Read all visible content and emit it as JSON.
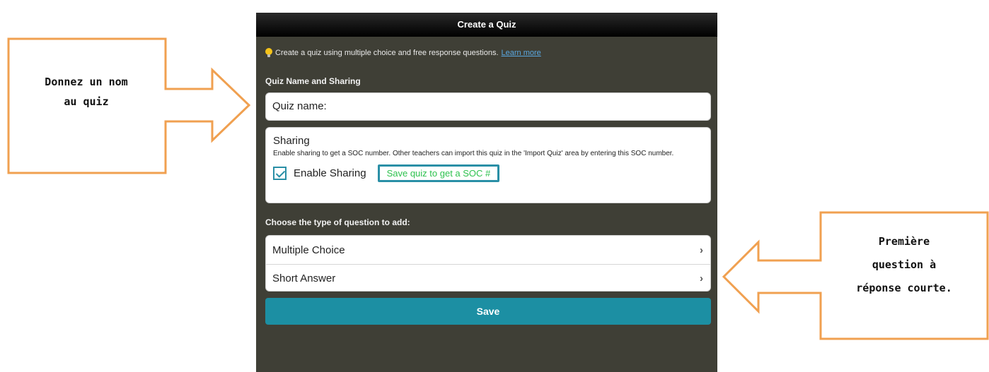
{
  "panel": {
    "title": "Create a Quiz",
    "info_text": "Create a quiz using multiple choice and free response questions.",
    "info_link": "Learn more",
    "section_quiz": "Quiz Name and Sharing",
    "quiz_name_placeholder": "Quiz name:",
    "sharing": {
      "title": "Sharing",
      "description": "Enable sharing to get a SOC number. Other teachers can import this quiz in the 'Import Quiz' area by entering this SOC number.",
      "checkbox_label": "Enable Sharing",
      "checked": true,
      "soc_button": "Save quiz to get a SOC #"
    },
    "section_questions": "Choose the type of question to add:",
    "question_types": [
      {
        "label": "Multiple Choice"
      },
      {
        "label": "Short Answer"
      }
    ],
    "save_label": "Save"
  },
  "callouts": {
    "left": {
      "line1": "Donnez un nom",
      "line2": "au quiz"
    },
    "right": {
      "line1": "Première",
      "line2": "question à",
      "line3": "réponse courte."
    }
  },
  "colors": {
    "panel_bg": "#3f3f36",
    "accent": "#1c8fa3",
    "soc_text": "#2ec24f",
    "callout_stroke": "#f0a050"
  }
}
